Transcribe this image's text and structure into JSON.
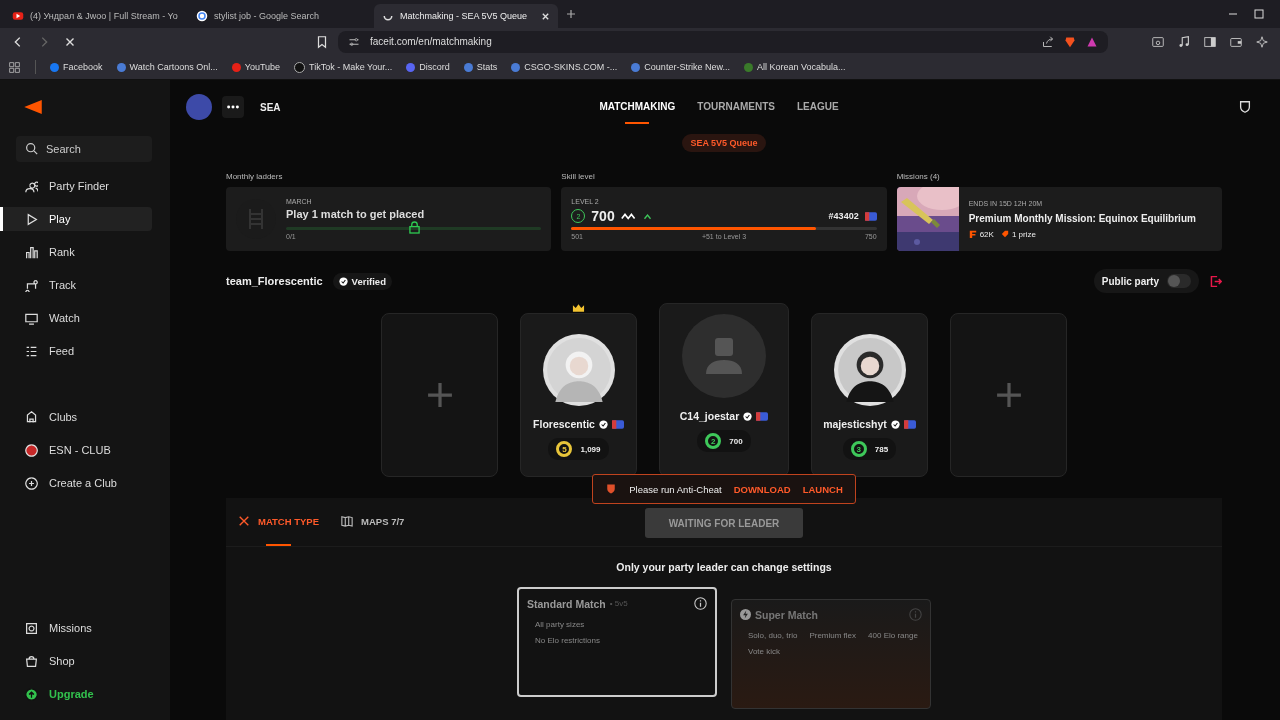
{
  "browser": {
    "tabs": [
      {
        "title": "(4) Ундрал & Jwoo | Full Stream - Yo",
        "selected": false,
        "loading": false
      },
      {
        "title": "stylist job - Google Search",
        "selected": false,
        "loading": false
      },
      {
        "title": "Matchmaking - SEA 5V5 Queue",
        "selected": true,
        "loading": true
      }
    ],
    "url": "faceit.com/en/matchmaking",
    "bookmarks": [
      "Facebook",
      "Watch Cartoons Onl...",
      "YouTube",
      "TikTok - Make Your...",
      "Discord",
      "Stats",
      "CSGO-SKINS.COM -...",
      "Counter-Strike New...",
      "All Korean Vocabula..."
    ]
  },
  "sidebar": {
    "search_placeholder": "Search",
    "nav_items": [
      {
        "label": "Party Finder",
        "selected": false
      },
      {
        "label": "Play",
        "selected": true
      },
      {
        "label": "Rank",
        "selected": false
      },
      {
        "label": "Track",
        "selected": false
      },
      {
        "label": "Watch",
        "selected": false
      },
      {
        "label": "Feed",
        "selected": false
      }
    ],
    "club_items": [
      {
        "label": "Clubs"
      },
      {
        "label": "ESN - CLUB"
      },
      {
        "label": "Create a Club"
      }
    ],
    "bottom_items": [
      {
        "label": "Missions",
        "accent": false
      },
      {
        "label": "Shop",
        "accent": false
      },
      {
        "label": "Upgrade",
        "accent": true
      }
    ]
  },
  "header": {
    "region": "SEA",
    "tabs": [
      {
        "label": "MATCHMAKING",
        "selected": true
      },
      {
        "label": "TOURNAMENTS",
        "selected": false
      },
      {
        "label": "LEAGUE",
        "selected": false
      }
    ]
  },
  "queue": "SEA 5V5 Queue",
  "ladders": {
    "heading": "Monthly ladders",
    "month": "MARCH",
    "text": "Play 1 match to get placed",
    "progress": "0/1",
    "level": 0
  },
  "skill": {
    "heading": "Skill level",
    "level_label": "LEVEL 2",
    "badge": "2",
    "elo": "700",
    "rank": "#43402",
    "min": "501",
    "hint": "+51 to Level 3",
    "max": "750",
    "level": 0.8
  },
  "missions": {
    "heading": "Missions (4)",
    "ends": "ENDS IN 15D 12H 20M",
    "title": "Premium Monthly Mission: Equinox Equilibrium",
    "points": "62K",
    "prizes": "1 prize"
  },
  "party": {
    "name": "team_Florescentic",
    "verified": "Verified",
    "public_label": "Public party",
    "public": false
  },
  "slots": [
    {
      "kind": "empty"
    },
    {
      "kind": "player",
      "name": "Florescentic",
      "level": "5",
      "elo": "1,099",
      "color": "#e8c53a",
      "leader": true,
      "has_photo": true
    },
    {
      "kind": "player",
      "name": "C14_joestar",
      "level": "2",
      "elo": "700",
      "color": "#3ec85a",
      "leader": false,
      "has_photo": false
    },
    {
      "kind": "player",
      "name": "majesticshyt",
      "level": "3",
      "elo": "785",
      "color": "#3ec85a",
      "leader": false,
      "has_photo": true
    },
    {
      "kind": "empty"
    }
  ],
  "anticheat": {
    "text": "Please run Anti-Cheat",
    "download": "DOWNLOAD",
    "launch": "LAUNCH"
  },
  "panel": {
    "tabs": [
      {
        "label": "MATCH TYPE",
        "selected": true
      },
      {
        "label": "MAPS 7/7",
        "selected": false
      }
    ],
    "button": "WAITING FOR LEADER",
    "notice": "Only your party leader can change settings",
    "match_types": [
      {
        "title": "Standard Match",
        "mode": "• 5v5",
        "selected": true,
        "features": [
          "All party sizes",
          "No Elo restrictions"
        ]
      },
      {
        "title": "Super Match",
        "selected": false,
        "features": [
          "Solo, duo, trio",
          "Premium flex",
          "400 Elo range",
          "Vote kick"
        ]
      }
    ]
  }
}
